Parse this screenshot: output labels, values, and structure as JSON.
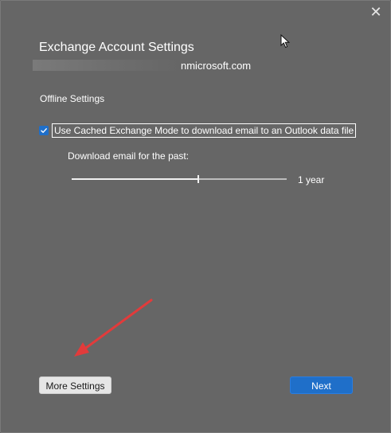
{
  "window": {
    "title": "Exchange Account Settings",
    "close_icon": "close-icon"
  },
  "account": {
    "email_suffix": "nmicrosoft.com"
  },
  "offline": {
    "section_label": "Offline Settings",
    "cached_mode_label": "Use Cached Exchange Mode to download email to an Outlook data file",
    "cached_mode_checked": true,
    "download_label": "Download email for the past:",
    "download_value": "1 year",
    "slider_level": 0.59
  },
  "buttons": {
    "more_settings": "More Settings",
    "next": "Next"
  },
  "colors": {
    "accent": "#1f6fc9",
    "annotation_arrow": "#e23b3b",
    "background": "#666666"
  }
}
